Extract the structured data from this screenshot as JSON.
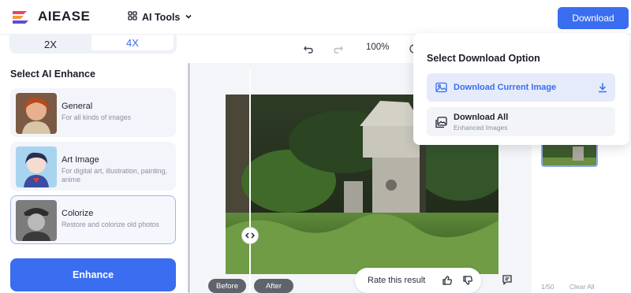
{
  "header": {
    "brand": "AIEASE",
    "tools_label": "AI Tools",
    "download_label": "Download"
  },
  "scale": {
    "options": [
      "2X",
      "4X"
    ],
    "selected": "4X"
  },
  "enhance": {
    "title": "Select AI Enhance",
    "items": [
      {
        "name": "General",
        "desc": "For all kinds of images"
      },
      {
        "name": "Art Image",
        "desc": "For digital art, illustration, painting, anime"
      },
      {
        "name": "Colorize",
        "desc": "Restore and colorize old photos"
      }
    ],
    "button_label": "Enhance"
  },
  "canvas": {
    "zoom": "100%",
    "before_label": "Before",
    "after_label": "After",
    "rate_label": "Rate this result"
  },
  "download_menu": {
    "title": "Select Download Option",
    "options": [
      {
        "label": "Download Current Image"
      },
      {
        "label": "Download All",
        "sub": "Enhanced Images"
      }
    ]
  },
  "sidebar": {
    "count": "1/50",
    "clear_label": "Clear All"
  },
  "colors": {
    "accent": "#3a6df0",
    "selected_bg": "#e5ebfb"
  },
  "icons": [
    "logo-icon",
    "grid-icon",
    "chevron-down-icon",
    "undo-icon",
    "redo-icon",
    "compare-icon",
    "image-icon",
    "download-arrow-icon",
    "images-icon",
    "thumbs-up-icon",
    "thumbs-down-icon",
    "chat-icon",
    "split-handle-icon"
  ]
}
